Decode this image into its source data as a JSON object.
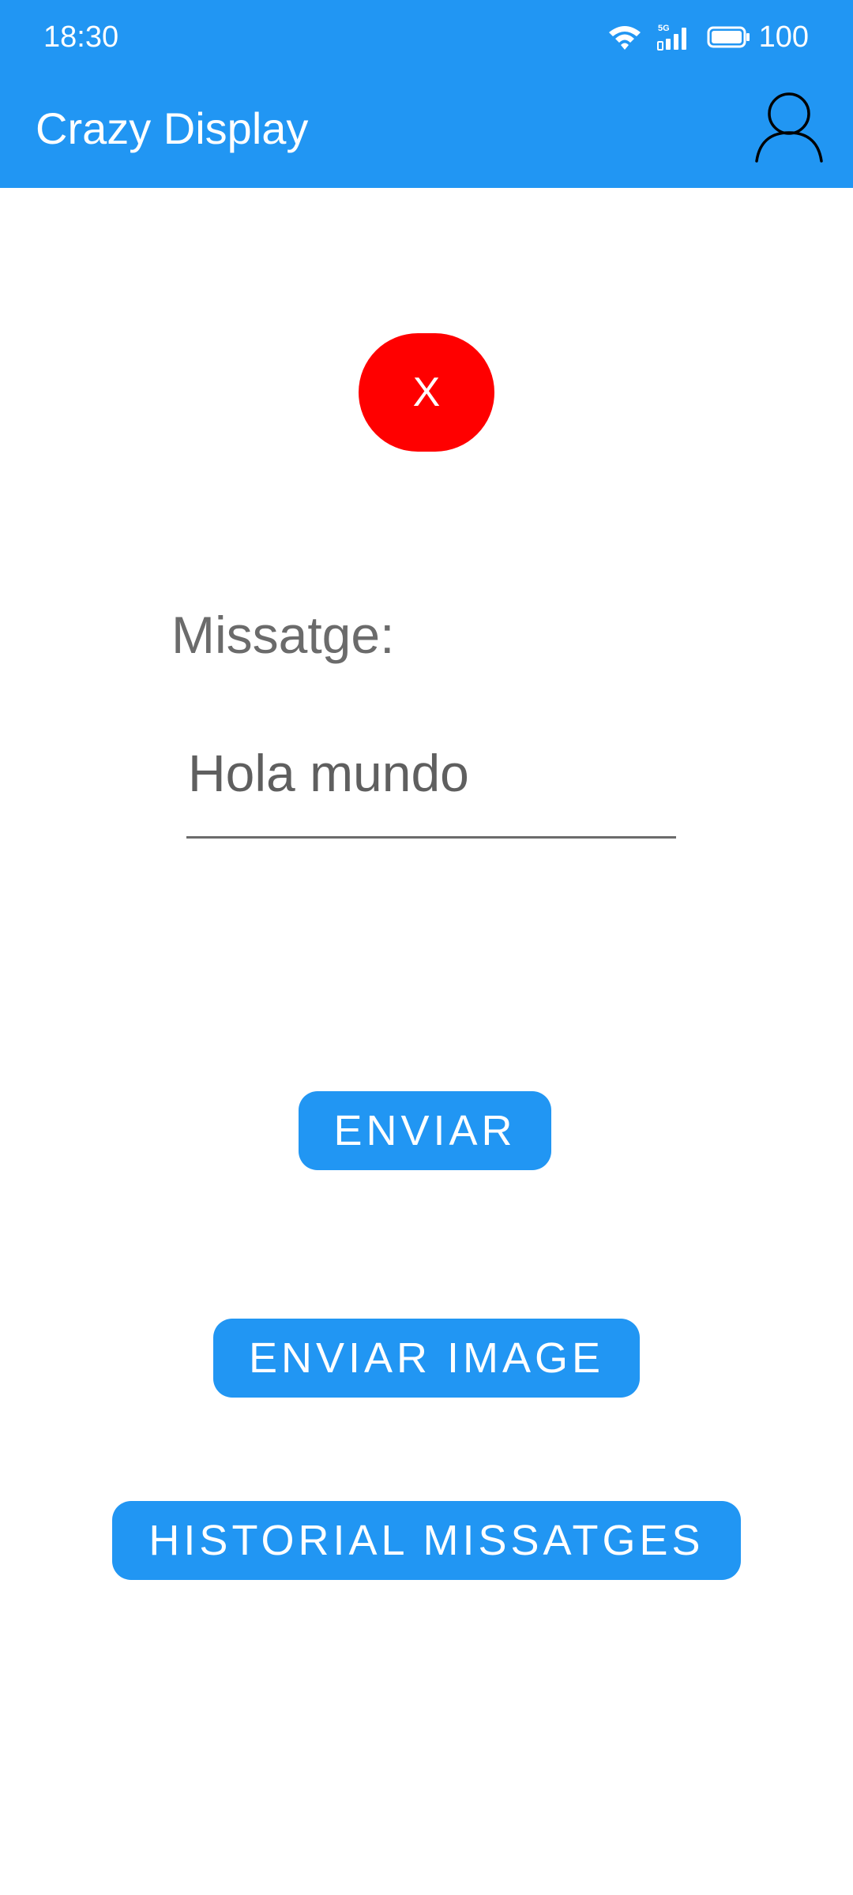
{
  "status_bar": {
    "time": "18:30",
    "network": "5G",
    "battery": "100",
    "icons": [
      "wifi-icon",
      "signal-5g-icon",
      "battery-icon"
    ]
  },
  "app_bar": {
    "title": "Crazy Display",
    "account_icon": "person-outline-icon",
    "background": "#2196F3"
  },
  "close_button": {
    "label": "X",
    "color": "#FF0000"
  },
  "message": {
    "label": "Missatge:",
    "value": "Hola mundo"
  },
  "buttons": {
    "send": "ENVIAR",
    "send_image": "ENVIAR IMAGE",
    "history": "HISTORIAL MISSATGES",
    "color": "#2196F3"
  }
}
